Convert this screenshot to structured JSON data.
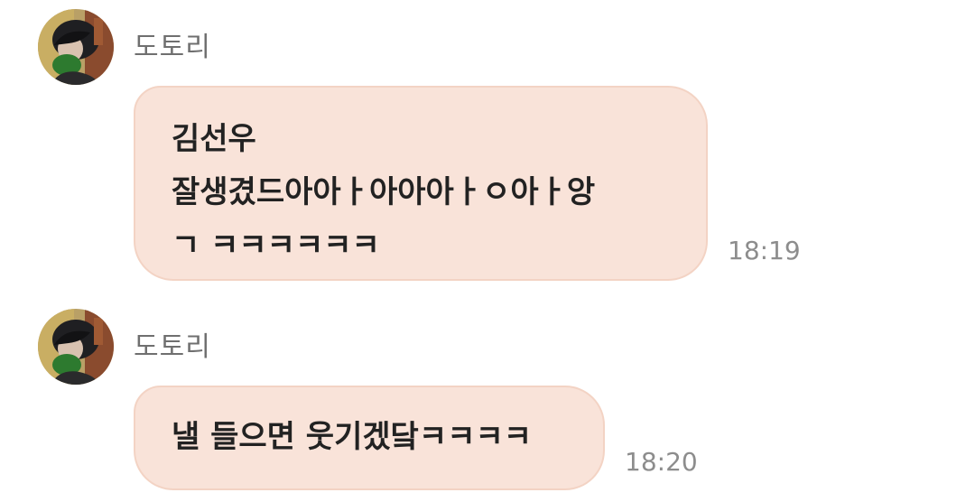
{
  "messages": [
    {
      "sender": "도토리",
      "lines": [
        "김선우",
        "잘생겼드아아ㅏ아아아ㅏㅇ아ㅏ앙",
        "ㄱ ㅋㅋㅋㅋㅋㅋ"
      ],
      "time": "18:19"
    },
    {
      "sender": "도토리",
      "lines": [
        "낼 들으면 웃기겠닼ㅋㅋㅋㅋ"
      ],
      "time": "18:20"
    }
  ],
  "colors": {
    "bubble_bg": "#f9e3d9",
    "bubble_border": "#f3d3c4",
    "sender_text": "#6f6f6f",
    "time_text": "#8d8d8d"
  },
  "icons": {
    "avatar": "profile-photo"
  }
}
